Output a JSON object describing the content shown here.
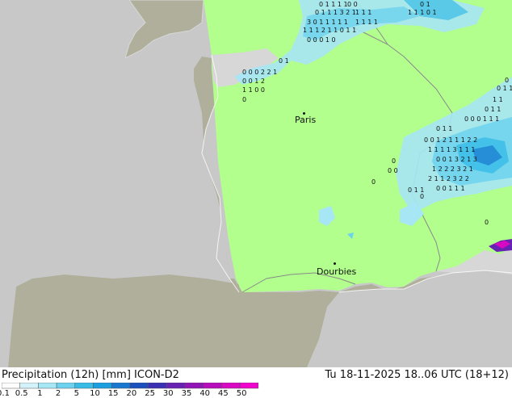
{
  "cities": [
    {
      "id": "paris",
      "name": "Paris"
    },
    {
      "id": "dourbies",
      "name": "Dourbies"
    }
  ],
  "footer": {
    "title": "Precipitation (12h) [mm] ICON-D2",
    "datetime": "Tu 18-11-2025 18..06 UTC (18+12)"
  },
  "legend": {
    "labels": [
      "0.1",
      "0.5",
      "1",
      "2",
      "5",
      "10",
      "15",
      "20",
      "25",
      "30",
      "35",
      "40",
      "45",
      "50"
    ],
    "colors": [
      "#ffffff",
      "#d4f2fa",
      "#a6e6f5",
      "#6dd2ee",
      "#38bce6",
      "#1c9fe0",
      "#1a77cf",
      "#1b4fbd",
      "#3b2fb3",
      "#6722b3",
      "#9014b6",
      "#b70cbc",
      "#d808c3",
      "#f004cd"
    ]
  },
  "colors": {
    "sea": "#c8c8c8",
    "land_outside": "#afaf9b",
    "model_domain": "#b2ff8d",
    "border": "#8a8a8a"
  }
}
